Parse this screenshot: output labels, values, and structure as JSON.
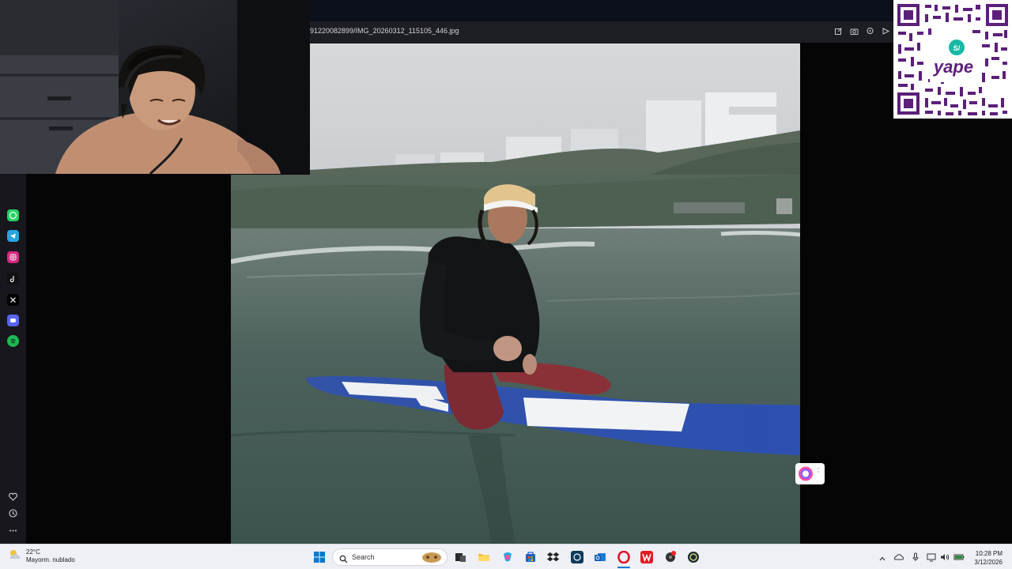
{
  "viewer": {
    "file_path": "91220082899/IMG_20260312_115105_446.jpg",
    "toolbar_icons": [
      "edit-icon",
      "camera-icon",
      "pin-icon",
      "share-icon"
    ]
  },
  "left_dock": {
    "apps": [
      "whatsapp-icon",
      "telegram-icon",
      "instagram-icon",
      "tiktok-icon",
      "x-icon",
      "discord-icon",
      "spotify-icon"
    ],
    "bottom": [
      "heart-icon",
      "history-icon",
      "more-icon"
    ]
  },
  "qr": {
    "brand_label": "yape",
    "badge_label": "S/"
  },
  "taskbar": {
    "weather_temp": "22°C",
    "weather_desc": "Mayorm. nublado",
    "search_placeholder": "Search",
    "time": "10:28 PM",
    "date": "3/12/2026"
  },
  "colors": {
    "accent_windows": "#0078d4",
    "qr_purple": "#5c1f7a",
    "viewer_bar": "#1d1d24"
  }
}
